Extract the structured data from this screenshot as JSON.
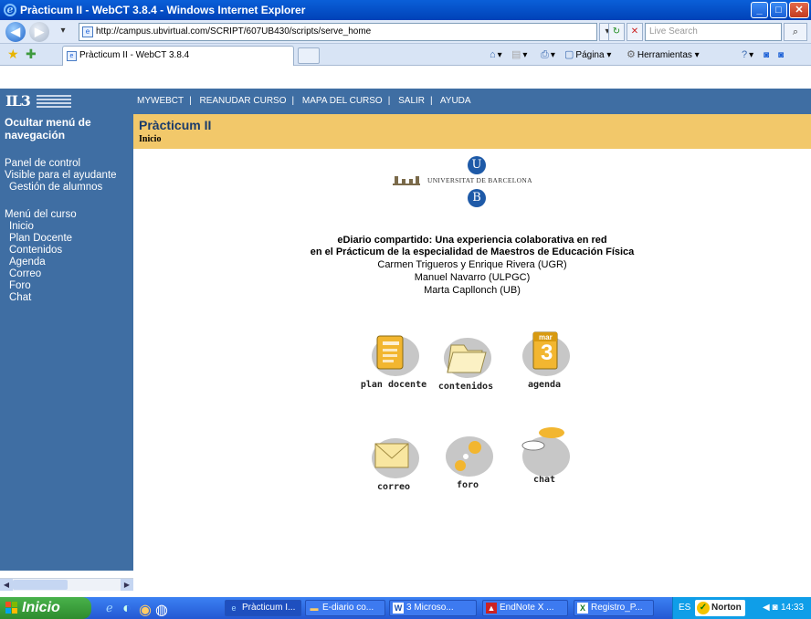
{
  "window": {
    "title": "Pràcticum II - WebCT 3.8.4 - Windows Internet Explorer"
  },
  "browser": {
    "url": "http://campus.ubvirtual.com/SCRIPT/607UB430/scripts/serve_home",
    "search_placeholder": "Live Search",
    "tab_title": "Pràcticum II - WebCT 3.8.4",
    "commands": {
      "page": "Página",
      "tools": "Herramientas"
    }
  },
  "webct": {
    "logo_text": "IL3",
    "top_nav": [
      "MYWEBCT",
      "REANUDAR CURSO",
      "MAPA DEL CURSO",
      "SALIR",
      "AYUDA"
    ],
    "toggle_menu": "Ocultar menú de navegación",
    "sidebar": {
      "control_panel": "Panel de control",
      "visible_assistant": "Visible para el ayudante",
      "manage_students": "Gestión de alumnos",
      "course_menu_title": "Menú del curso",
      "course_menu": [
        "Inicio",
        "Plan Docente",
        "Contenidos",
        "Agenda",
        "Correo",
        "Foro",
        "Chat"
      ]
    },
    "course_title": "Pràcticum II",
    "breadcrumb": "Inicio"
  },
  "main": {
    "university_name": "UNIVERSITAT DE BARCELONA",
    "logo_letters": [
      "U",
      "B"
    ],
    "heading_line1": "eDiario compartido: Una experiencia colaborativa en red",
    "heading_line2": "en el Prácticum de la especialidad de Maestros de Educación Física",
    "author_line1": "Carmen Trigueros y Enrique Rivera (UGR)",
    "author_line2": "Manuel Navarro (ULPGC)",
    "author_line3": "Marta Capllonch (UB)",
    "tools": [
      {
        "label": "plan docente",
        "icon": "document-icon"
      },
      {
        "label": "contenidos",
        "icon": "folder-icon"
      },
      {
        "label": "agenda",
        "icon": "calendar-icon",
        "badge_month": "mar",
        "badge_day": "3"
      },
      {
        "label": "correo",
        "icon": "envelope-icon"
      },
      {
        "label": "foro",
        "icon": "forum-icon"
      },
      {
        "label": "chat",
        "icon": "chat-bubble-icon"
      }
    ]
  },
  "taskbar": {
    "start_label": "Inicio",
    "tasks": [
      "Pràcticum I...",
      "E-diario co...",
      "3 Microso...",
      "EndNote X ...",
      "Registro_P..."
    ],
    "language": "ES",
    "norton": "Norton",
    "clock": "14:33"
  },
  "colors": {
    "sidebar": "#3f6ea3",
    "header": "#f2c86a",
    "ub_blue": "#1e5aa8"
  }
}
